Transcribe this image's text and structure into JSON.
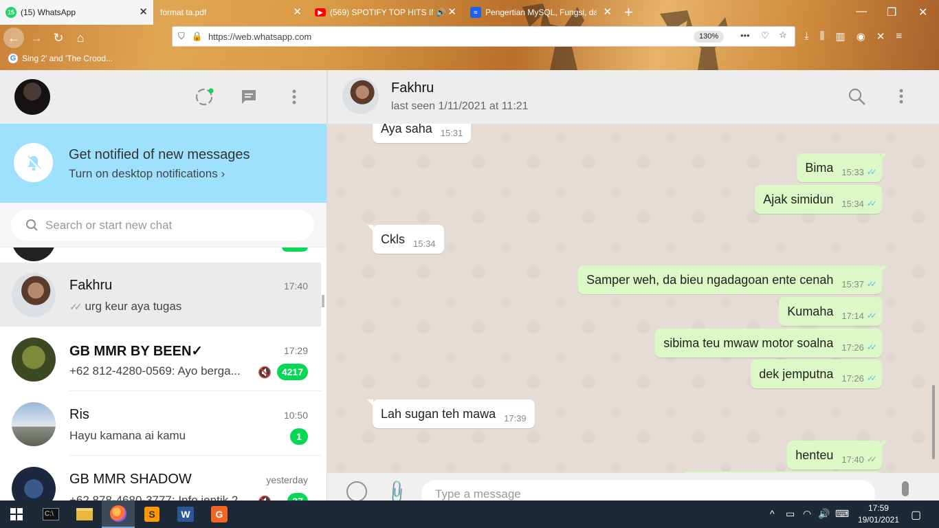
{
  "browser": {
    "tabs": [
      {
        "label": "(15) WhatsApp",
        "favicon": "whatsapp-icon",
        "favicon_color": "#25d366",
        "favicon_text": "15",
        "active": true
      },
      {
        "label": "format ta.pdf",
        "favicon": "pdf-icon",
        "active": false
      },
      {
        "label": "(569) SPOTIFY TOP HITS INL",
        "favicon": "youtube-icon",
        "favicon_color": "#ff0000",
        "active": false
      },
      {
        "label": "Pengertian MySQL, Fungsi, da",
        "favicon": "website-icon",
        "favicon_color": "#1e63e9",
        "active": false
      }
    ],
    "url": "https://web.whatsapp.com",
    "zoom": "130%",
    "bookmark": "Sing 2' and 'The Crood..."
  },
  "notification_banner": {
    "title": "Get notified of new messages",
    "subtitle": "Turn on desktop notifications ›"
  },
  "search": {
    "placeholder": "Search or start new chat"
  },
  "chats": [
    {
      "name": "Fakhru",
      "time": "17:40",
      "preview": "urg keur aya tugas",
      "ticks": "✓✓",
      "selected": true
    },
    {
      "name": "GB MMR BY BEEN✓",
      "time": "17:29",
      "preview": "+62 812-4280-0569: Ayo berga...",
      "badge": "4217",
      "muted": true
    },
    {
      "name": "Ris",
      "time": "10:50",
      "preview": "Hayu kamana ai kamu",
      "badge": "1"
    },
    {
      "name": "GB MMR SHADOW",
      "time": "yesterday",
      "preview": "+62 878-4680-3777: Info jentik 2...",
      "badge": "37",
      "muted": true
    }
  ],
  "conversation": {
    "contact_name": "Fakhru",
    "status": "last seen 1/11/2021 at 11:21",
    "messages": [
      {
        "direction": "in",
        "text": "Aya saha",
        "time": "15:31"
      },
      {
        "direction": "out",
        "text": "Bima",
        "time": "15:33",
        "read": true
      },
      {
        "direction": "out",
        "text": "Ajak simidun",
        "time": "15:34",
        "read": true
      },
      {
        "direction": "in",
        "text": "Ckls",
        "time": "15:34"
      },
      {
        "direction": "out",
        "text": "Samper weh, da bieu ngadagoan ente cenah",
        "time": "15:37",
        "read": true
      },
      {
        "direction": "out",
        "text": "Kumaha",
        "time": "17:14",
        "read": true
      },
      {
        "direction": "out",
        "text": "sibima teu mwaw motor soalna",
        "time": "17:26",
        "read": true
      },
      {
        "direction": "out",
        "text": "dek jemputna",
        "time": "17:26",
        "read": true
      },
      {
        "direction": "in",
        "text": "Lah sugan teh mawa",
        "time": "17:39"
      },
      {
        "direction": "out",
        "text": "henteu",
        "time": "17:40",
        "read": false
      }
    ],
    "compose_placeholder": "Type a message"
  },
  "taskbar": {
    "time": "17:59",
    "date": "19/01/2021",
    "apps": [
      "terminal-icon",
      "file-explorer-icon",
      "firefox-icon",
      "sublime-text-icon",
      "word-icon",
      "foxit-reader-icon"
    ]
  },
  "colors": {
    "notify_banner": "#9de1fe",
    "outgoing_bubble": "#dcf8c6",
    "chat_bg": "#e5ddd5",
    "badge_green": "#06d755",
    "read_tick": "#4fc3f7"
  }
}
